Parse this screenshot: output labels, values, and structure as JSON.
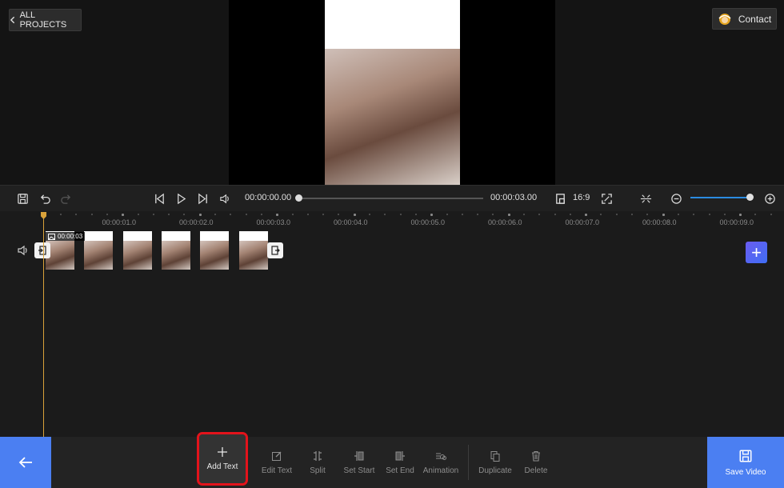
{
  "header": {
    "all_projects_label": "ALL PROJECTS",
    "contact_label": "Contact"
  },
  "controls": {
    "current_time": "00:00:00.00",
    "total_time": "00:00:03.00",
    "aspect_ratio": "16:9",
    "seek_progress": 0,
    "zoom_level": 0.92
  },
  "timeline": {
    "ticks": [
      "00:00:01.0",
      "00:00:02.0",
      "00:00:03.0",
      "00:00:04.0",
      "00:00:05.0",
      "00:00:06.0",
      "00:00:07.0",
      "00:00:08.0",
      "00:00:09.0"
    ],
    "clip": {
      "duration": "00:00:03",
      "thumbnail_count": 6
    }
  },
  "toolbar": {
    "tools": [
      {
        "id": "add-text",
        "label": "Add Text",
        "icon": "plus-icon"
      },
      {
        "id": "edit-text",
        "label": "Edit Text",
        "icon": "edit-icon"
      },
      {
        "id": "split",
        "label": "Split",
        "icon": "split-icon"
      },
      {
        "id": "set-start",
        "label": "Set Start",
        "icon": "set-start-icon"
      },
      {
        "id": "set-end",
        "label": "Set End",
        "icon": "set-end-icon"
      },
      {
        "id": "animation",
        "label": "Animation",
        "icon": "animation-icon"
      },
      {
        "id": "duplicate",
        "label": "Duplicate",
        "icon": "duplicate-icon"
      },
      {
        "id": "delete",
        "label": "Delete",
        "icon": "trash-icon"
      }
    ],
    "save_label": "Save Video"
  },
  "colors": {
    "accent": "#4b7ff2",
    "playhead": "#d9a23a",
    "highlight": "#e3131b",
    "zoom_track": "#2b8be0"
  }
}
